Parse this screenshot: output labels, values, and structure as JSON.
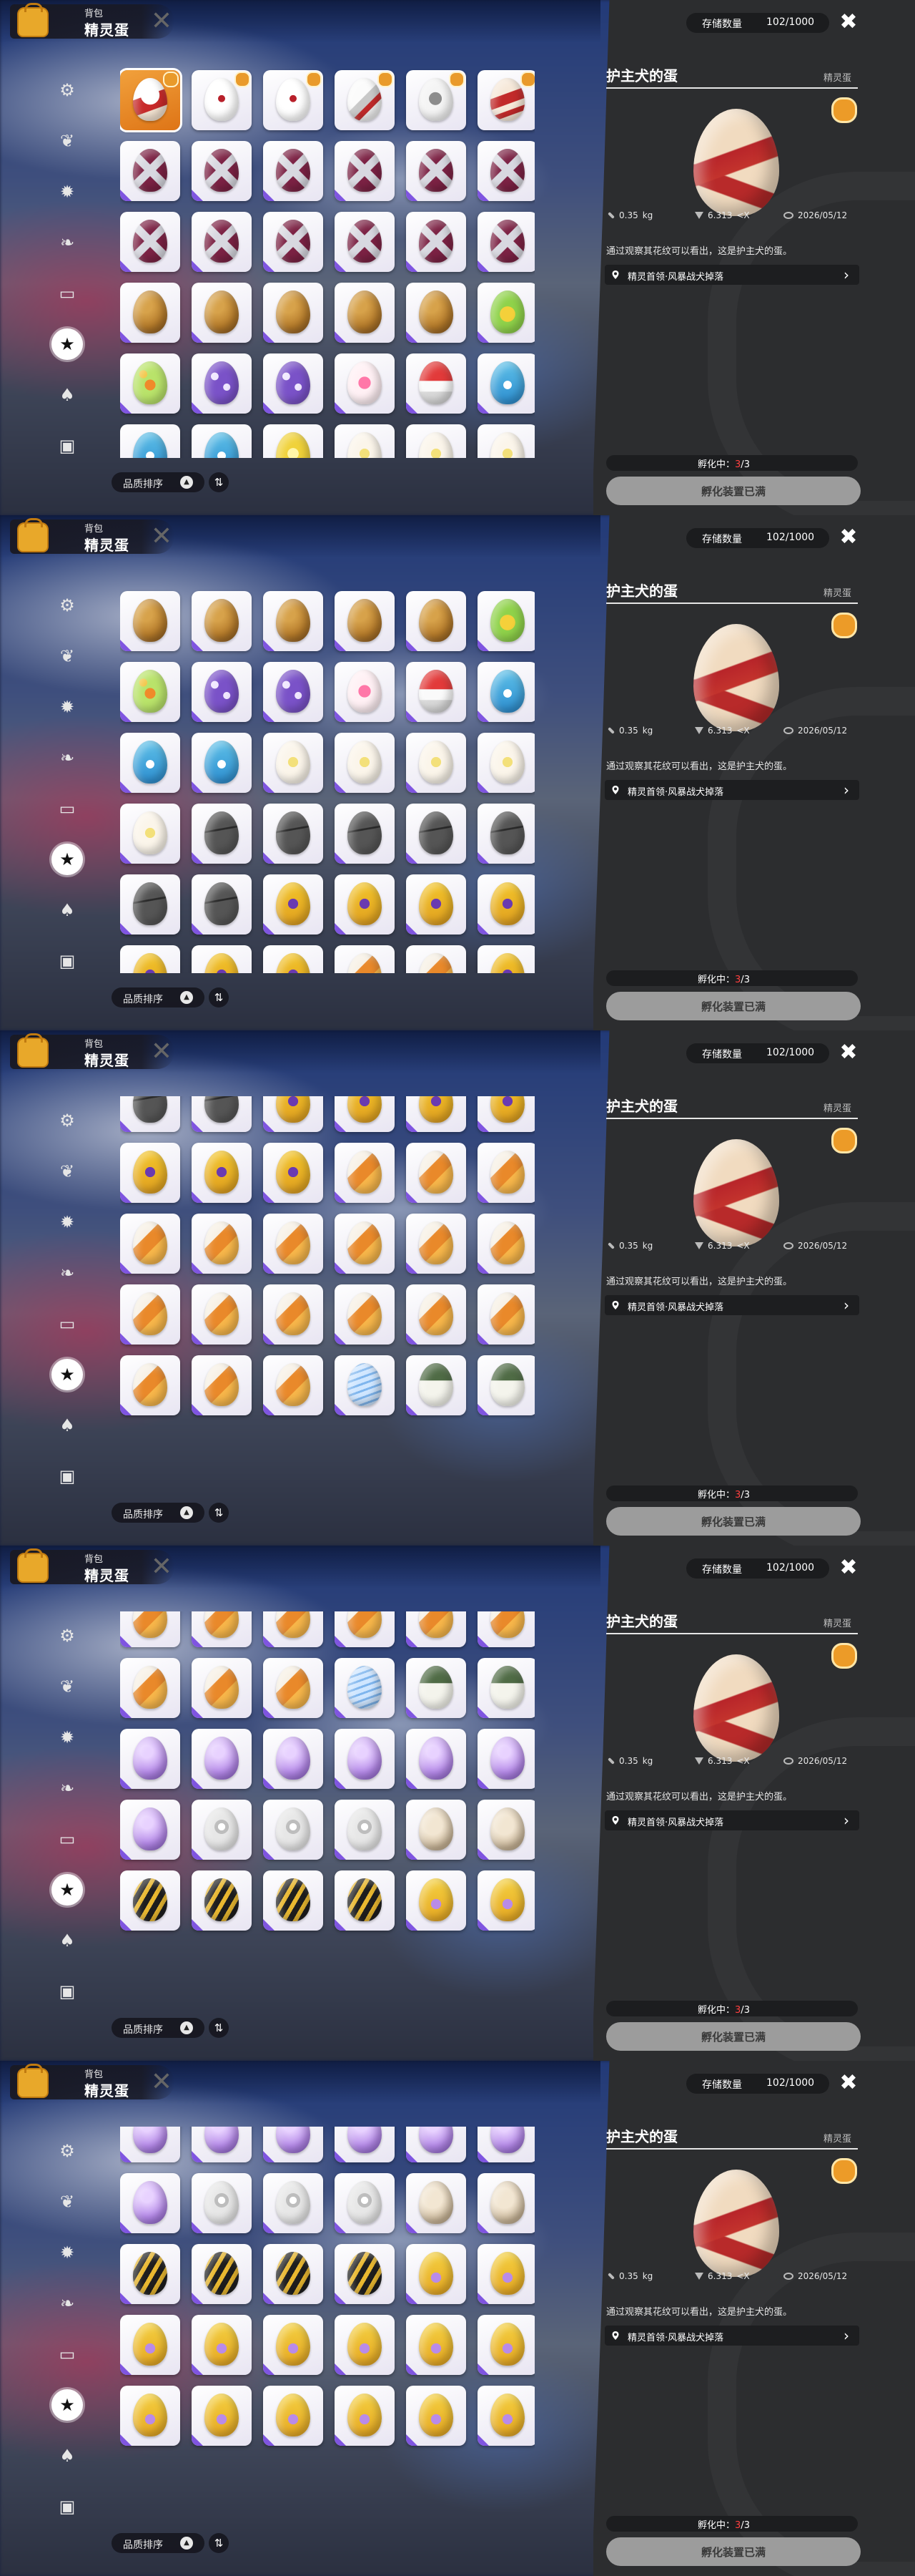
{
  "header": {
    "bag_label": "背包",
    "title": "精灵蛋"
  },
  "sidebar": {
    "items": [
      "settings-gear-icon",
      "leaf-icon",
      "sun-burst-icon",
      "bird-icon",
      "box-icon",
      "star-icon",
      "acorn-icon",
      "chest-icon"
    ],
    "active_index": 5
  },
  "sort": {
    "label": "品质排序",
    "direction_glyph": "▲",
    "toggle_glyph": "⇅"
  },
  "storage": {
    "label": "存储数量",
    "value": "102/1000"
  },
  "details": {
    "name": "护主犬的蛋",
    "category": "精灵蛋",
    "weight": "0.35",
    "weight_unit": "kg",
    "hatch_time": "6.313",
    "hatch_time_unit": "<X",
    "date": "2026/05/12",
    "description": "通过观察其花纹可以看出，这是护主犬的蛋。",
    "source": "精灵首领·风暴战犬掉落"
  },
  "hatch": {
    "label_prefix": "孵化中：",
    "current": "3",
    "separator": "/",
    "total": "3",
    "button": "孵化装置已满"
  },
  "colors": {
    "accent_orange": "#e6862a",
    "rarity_purple": "#7f55e0",
    "panel_dark": "#2c2d2f",
    "hatch_red": "#ff4040"
  },
  "panels": [
    {
      "scroll_row": 0,
      "rows": [
        [
          "red-white-selected",
          "white-red-spot",
          "white-red-spot",
          "white-gray-red",
          "white-gray-patch",
          "red-white"
        ],
        [
          "maroon-x",
          "maroon-x",
          "maroon-x",
          "maroon-x",
          "maroon-x",
          "maroon-x"
        ],
        [
          "maroon-x",
          "maroon-x",
          "maroon-x",
          "maroon-x",
          "maroon-x",
          "maroon-x"
        ],
        [
          "brown",
          "brown",
          "brown",
          "brown",
          "brown",
          "green-yellow"
        ],
        [
          "green-orange-dots",
          "purple-dots",
          "purple-dots",
          "pink-flower",
          "red-white-cap",
          "blue-teal"
        ],
        [
          "blue-teal",
          "blue-teal",
          "yellow-star",
          "cream-star",
          "cream-star",
          "cream-star"
        ]
      ]
    },
    {
      "scroll_row": 3,
      "rows": [
        [
          "brown",
          "brown",
          "brown",
          "brown",
          "brown",
          "green-yellow"
        ],
        [
          "green-orange-dots",
          "purple-dots",
          "purple-dots",
          "pink-flower",
          "red-white-cap",
          "blue-teal"
        ],
        [
          "blue-teal",
          "blue-teal",
          "cream-star",
          "cream-star",
          "cream-star",
          "cream-star"
        ],
        [
          "cream-star",
          "dark-gray",
          "dark-gray",
          "dark-gray",
          "dark-gray",
          "dark-gray"
        ],
        [
          "dark-gray",
          "dark-gray",
          "yellow-purple",
          "yellow-purple",
          "yellow-purple",
          "yellow-purple"
        ],
        [
          "yellow-purple",
          "yellow-purple",
          "yellow-purple",
          "orange-white",
          "orange-white",
          "yellow-purple"
        ]
      ]
    },
    {
      "scroll_row": 6,
      "rows": [
        [
          "dark-gray",
          "dark-gray",
          "yellow-purple",
          "yellow-purple",
          "yellow-purple",
          "yellow-purple"
        ],
        [
          "yellow-purple",
          "yellow-purple",
          "yellow-purple",
          "orange-white",
          "orange-white",
          "orange-white"
        ],
        [
          "orange-white",
          "orange-white",
          "orange-white",
          "orange-white",
          "orange-white",
          "orange-white"
        ],
        [
          "orange-white",
          "orange-white",
          "orange-white",
          "orange-white",
          "orange-white",
          "orange-white"
        ],
        [
          "orange-white",
          "orange-white",
          "orange-white",
          "blue-wave",
          "green-white",
          "green-white"
        ]
      ]
    },
    {
      "scroll_row": 8,
      "rows": [
        [
          "orange-white",
          "orange-white",
          "orange-white",
          "orange-white",
          "orange-white",
          "orange-white"
        ],
        [
          "orange-white",
          "orange-white",
          "orange-white",
          "blue-wave",
          "green-white",
          "green-white"
        ],
        [
          "lavender",
          "lavender",
          "lavender",
          "lavender",
          "lavender",
          "lavender"
        ],
        [
          "lavender",
          "silver-shell",
          "silver-shell",
          "silver-shell",
          "tan-shell",
          "tan-shell"
        ],
        [
          "black-yellow-stripe",
          "black-yellow-stripe",
          "black-yellow-stripe",
          "black-yellow-stripe",
          "gold-lavender",
          "gold-lavender"
        ]
      ]
    },
    {
      "scroll_row": 10,
      "rows": [
        [
          "lavender",
          "lavender",
          "lavender",
          "lavender",
          "lavender",
          "lavender"
        ],
        [
          "lavender",
          "silver-shell",
          "silver-shell",
          "silver-shell",
          "tan-shell",
          "tan-shell"
        ],
        [
          "black-yellow-stripe",
          "black-yellow-stripe",
          "black-yellow-stripe",
          "black-yellow-stripe",
          "gold-lavender",
          "gold-lavender"
        ],
        [
          "gold-lavender",
          "gold-lavender",
          "gold-lavender",
          "gold-lavender",
          "gold-lavender",
          "gold-lavender"
        ],
        [
          "gold-lavender",
          "gold-lavender",
          "gold-lavender",
          "gold-lavender",
          "gold-lavender",
          "gold-lavender"
        ]
      ]
    }
  ]
}
